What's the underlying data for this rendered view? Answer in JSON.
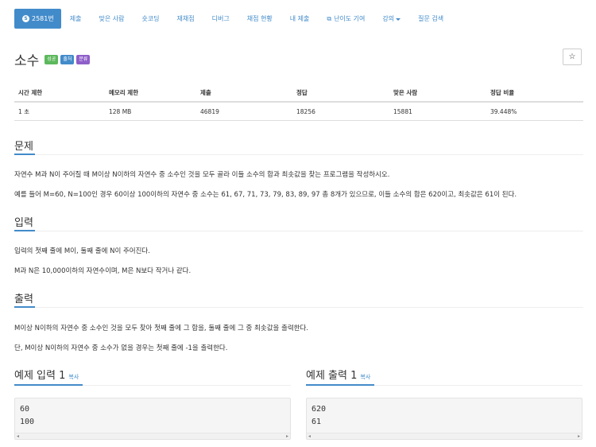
{
  "nav": {
    "active": {
      "badge": "S",
      "label": "2581번"
    },
    "items": [
      "제출",
      "맞은 사람",
      "숏코딩",
      "재채점",
      "디버그",
      "채점 현황",
      "내 제출",
      "난이도 기여",
      "강의",
      "질문 검색"
    ]
  },
  "problem": {
    "title": "소수",
    "labels": {
      "success": "성공",
      "source": "출처",
      "category": "분류"
    },
    "star_icon": "☆"
  },
  "info": {
    "headers": [
      "시간 제한",
      "메모리 제한",
      "제출",
      "정답",
      "맞은 사람",
      "정답 비율"
    ],
    "values": [
      "1 초",
      "128 MB",
      "46819",
      "18256",
      "15881",
      "39.448%"
    ]
  },
  "sections": {
    "description": {
      "heading": "문제",
      "lines": [
        "자연수 M과 N이 주어질 때 M이상 N이하의 자연수 중 소수인 것을 모두 골라 이들 소수의 합과 최솟값을 찾는 프로그램을 작성하시오.",
        "예를 들어 M=60, N=100인 경우 60이상 100이하의 자연수 중 소수는 61, 67, 71, 73, 79, 83, 89, 97 총 8개가 있으므로, 이들 소수의 합은 620이고, 최솟값은 61이 된다."
      ]
    },
    "input": {
      "heading": "입력",
      "lines": [
        "입력의 첫째 줄에 M이, 둘째 줄에 N이 주어진다.",
        "M과 N은 10,000이하의 자연수이며, M은 N보다 작거나 같다."
      ]
    },
    "output": {
      "heading": "출력",
      "lines": [
        "M이상 N이하의 자연수 중 소수인 것을 모두 찾아 첫째 줄에 그 합을, 둘째 줄에 그 중 최솟값을 출력한다.",
        "단, M이상 N이하의 자연수 중 소수가 없을 경우는 첫째 줄에 -1을 출력한다."
      ]
    }
  },
  "samples": {
    "input": {
      "heading": "예제 입력 1",
      "copy": "복사",
      "line1": "60",
      "line2": "100"
    },
    "output": {
      "heading": "예제 출력 1",
      "copy": "복사",
      "line1": "620",
      "line2": "61"
    }
  },
  "colors": {
    "accent": "#428bca",
    "success": "#5cb85c",
    "purple": "#8e5ec9"
  }
}
